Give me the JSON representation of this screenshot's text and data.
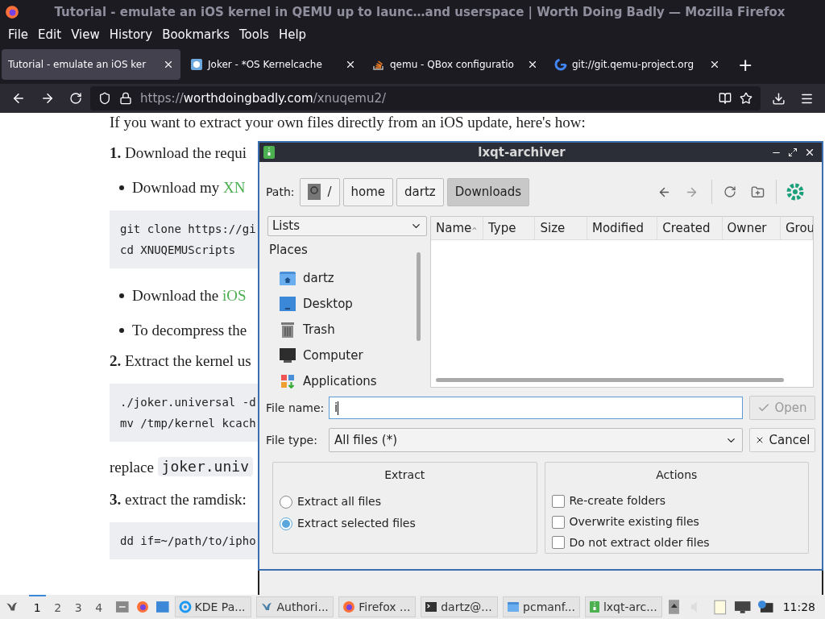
{
  "window": {
    "title": "Tutorial - emulate an iOS kernel in QEMU up to launc…and userspace | Worth Doing Badly — Mozilla Firefox"
  },
  "menu": [
    "File",
    "Edit",
    "View",
    "History",
    "Bookmarks",
    "Tools",
    "Help"
  ],
  "tabs": [
    {
      "label": "Tutorial - emulate an iOS ker",
      "selected": true,
      "kind": "page"
    },
    {
      "label": "Joker - *OS Kernelcache",
      "selected": false,
      "kind": "joker"
    },
    {
      "label": "qemu - QBox configuratio",
      "selected": false,
      "kind": "stack"
    },
    {
      "label": "git://git.qemu-project.org",
      "selected": false,
      "kind": "google"
    }
  ],
  "new_tab": "+",
  "address": {
    "scheme": "https://",
    "host": "worthdoingbadly.com",
    "path": "/xnuqemu2/"
  },
  "article": [
    {
      "kind": "para",
      "text": "If you want to extract your own files directly from an iOS update, here's how:"
    },
    {
      "kind": "para",
      "text": "**1.** Download the requi"
    },
    {
      "kind": "bullet",
      "text": "Download my ",
      "link": "XN"
    },
    {
      "kind": "code",
      "lines": [
        "git clone https://gi",
        "cd XNUQEMUScripts"
      ]
    },
    {
      "kind": "bullet",
      "text": "Download the ",
      "link": "iOS"
    },
    {
      "kind": "bullet",
      "text": "To decompress the"
    },
    {
      "kind": "para",
      "text": "**2.** Extract the kernel us"
    },
    {
      "kind": "code",
      "lines": [
        "./joker.universal -d",
        "mv /tmp/kernel kcach"
      ]
    },
    {
      "kind": "inline",
      "text": "replace ",
      "code": "joker.univ"
    },
    {
      "kind": "para",
      "text": "**3.** extract the ramdisk:"
    },
    {
      "kind": "code",
      "lines": [
        "dd if=~/path/to/ipho"
      ]
    }
  ],
  "dialog": {
    "title": "lxqt-archiver",
    "path_label": "Path:",
    "path": [
      {
        "label": "/",
        "selected": false,
        "kind": "root"
      },
      {
        "label": "home",
        "selected": false
      },
      {
        "label": "dartz",
        "selected": false
      },
      {
        "label": "Downloads",
        "selected": true
      }
    ],
    "view_select": "Lists",
    "places_title": "Places",
    "places": [
      {
        "label": "dartz",
        "kind": "home"
      },
      {
        "label": "Desktop",
        "kind": "desktop"
      },
      {
        "label": "Trash",
        "kind": "trash"
      },
      {
        "label": "Computer",
        "kind": "computer"
      },
      {
        "label": "Applications",
        "kind": "apps"
      }
    ],
    "columns": [
      {
        "label": "Name",
        "sorted": true
      },
      {
        "label": "Type",
        "sorted": false
      },
      {
        "label": "Size",
        "sorted": false
      },
      {
        "label": "Modified",
        "sorted": false
      },
      {
        "label": "Created",
        "sorted": false
      },
      {
        "label": "Owner",
        "sorted": false
      },
      {
        "label": "Grou",
        "sorted": false
      }
    ],
    "file_name_label": "File name:",
    "file_name": "i",
    "open": {
      "label": "Open",
      "disabled": true
    },
    "file_type_label": "File type:",
    "file_type": "All files (*)",
    "cancel": "Cancel",
    "extract": {
      "title": "Extract",
      "options": [
        {
          "label": "Extract all files",
          "selected": false
        },
        {
          "label": "Extract selected files",
          "selected": true
        }
      ]
    },
    "actions": {
      "title": "Actions",
      "options": [
        {
          "label": "Re-create folders",
          "checked": false
        },
        {
          "label": "Overwrite existing files",
          "checked": false
        },
        {
          "label": "Do not extract older files",
          "checked": false
        }
      ]
    }
  },
  "taskbar": {
    "workspaces": [
      {
        "label": "1",
        "selected": true
      },
      {
        "label": "2",
        "selected": false
      },
      {
        "label": "3",
        "selected": false
      },
      {
        "label": "4",
        "selected": false
      }
    ],
    "tasks": [
      {
        "label": "KDE Pa...",
        "kind": "kde"
      },
      {
        "label": "Authori...",
        "kind": "auth"
      },
      {
        "label": "Firefox ...",
        "kind": "firefox"
      },
      {
        "label": "dartz@...",
        "kind": "terminal"
      },
      {
        "label": "pcmanf...",
        "kind": "folder"
      },
      {
        "label": "lxqt-arc...",
        "kind": "archive"
      }
    ],
    "clock": "11:28"
  }
}
